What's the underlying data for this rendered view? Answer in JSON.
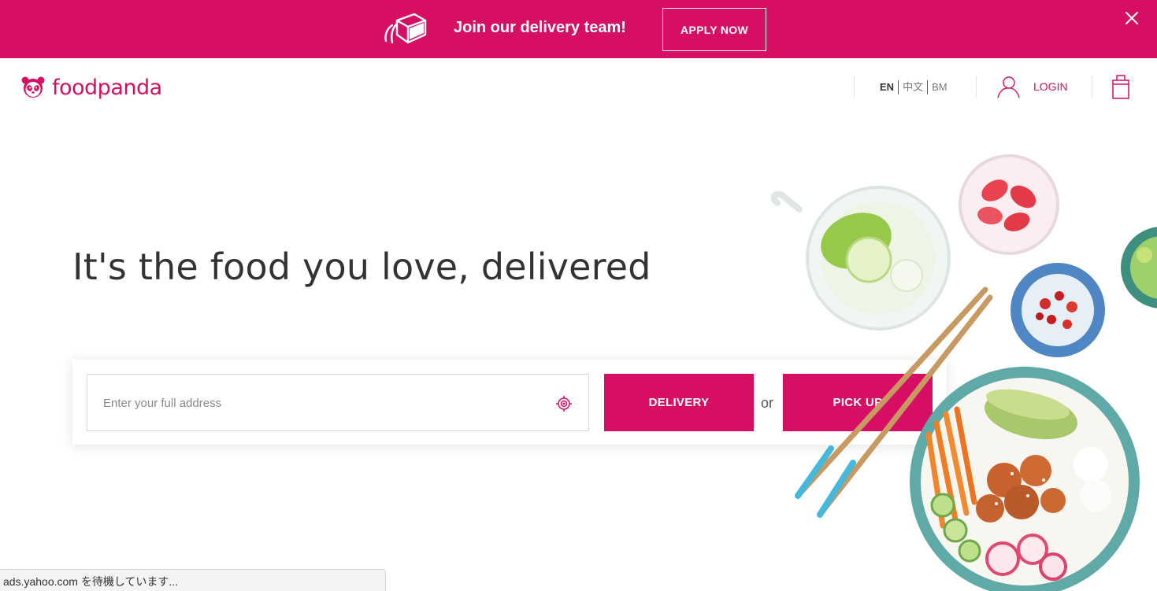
{
  "banner": {
    "text": "Join our delivery team!",
    "apply_label": "APPLY NOW",
    "close_icon": "close-icon",
    "icon": "delivery-box-icon",
    "background": "#d70f64"
  },
  "header": {
    "logo_text": "foodpanda",
    "logo_icon": "panda-logo-icon",
    "languages": [
      "EN",
      "中文",
      "BM"
    ],
    "active_language": "EN",
    "login_label": "LOGIN",
    "login_icon": "user-icon",
    "cart_icon": "shopping-bag-icon"
  },
  "hero": {
    "headline": "It's the food you love, delivered"
  },
  "search": {
    "placeholder": "Enter your full address",
    "value": "",
    "locate_icon": "locate-target-icon",
    "delivery_label": "DELIVERY",
    "or_text": "or",
    "pickup_label": "PICK UP"
  },
  "status_bar": {
    "text": "ads.yahoo.com を待機しています..."
  },
  "colors": {
    "brand": "#d70f64",
    "text": "#333333"
  }
}
